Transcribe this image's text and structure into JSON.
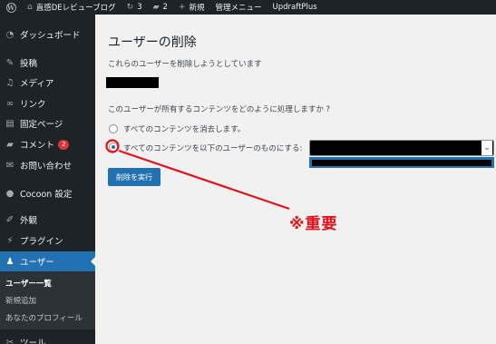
{
  "admin_bar": {
    "site_name": "直感DEレビューブログ",
    "updates_count": "3",
    "comments_count": "2",
    "new_label": "新規",
    "admin_menu_label": "管理メニュー",
    "plugin_label": "UpdraftPlus"
  },
  "sidebar": {
    "items": [
      {
        "label": "ダッシュボード",
        "icon": "dashboard-icon"
      },
      {
        "label": "投稿",
        "icon": "pin-icon"
      },
      {
        "label": "メディア",
        "icon": "media-icon"
      },
      {
        "label": "リンク",
        "icon": "link-icon"
      },
      {
        "label": "固定ページ",
        "icon": "page-icon"
      },
      {
        "label": "コメント",
        "icon": "comment-icon",
        "badge": "2"
      },
      {
        "label": "お問い合わせ",
        "icon": "mail-icon"
      },
      {
        "label": "Cocoon 設定",
        "icon": "cocoon-icon"
      },
      {
        "label": "外観",
        "icon": "brush-icon"
      },
      {
        "label": "プラグイン",
        "icon": "plugin-icon"
      },
      {
        "label": "ユーザー",
        "icon": "user-icon"
      },
      {
        "label": "ツール",
        "icon": "tools-icon"
      }
    ],
    "submenu": [
      "ユーザー一覧",
      "新規追加",
      "あなたのプロフィール"
    ]
  },
  "main": {
    "title": "ユーザーの削除",
    "intro": "これらのユーザーを削除しようとしています",
    "question": "このユーザーが所有するコンテンツをどのように処理しますか ?",
    "option_delete": "すべてのコンテンツを消去します。",
    "option_attribute": "すべてのコンテンツを以下のユーザーのものにする:",
    "selected_option": "attribute",
    "submit_label": "削除を実行"
  },
  "annotation": {
    "text": "※重要",
    "color": "#e0121a"
  },
  "colors": {
    "admin_dark": "#1d2327",
    "accent": "#2271b1",
    "badge": "#d63638"
  }
}
